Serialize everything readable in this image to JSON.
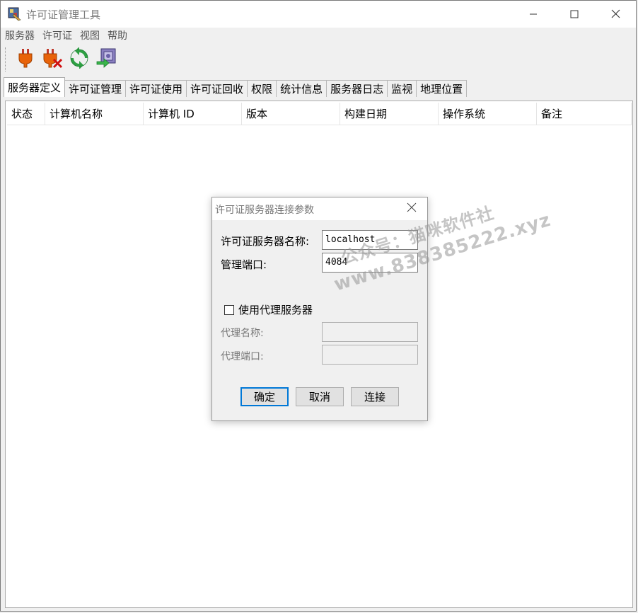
{
  "window": {
    "title": "许可证管理工具",
    "minimize": "—",
    "maximize": "☐",
    "close": "✕"
  },
  "menu": {
    "items": [
      "服务器",
      "许可证",
      "视图",
      "帮助"
    ]
  },
  "toolbar": {
    "buttons": [
      "connect-plug-icon",
      "disconnect-plug-icon",
      "refresh-icon",
      "export-icon"
    ]
  },
  "tabs": {
    "items": [
      "服务器定义",
      "许可证管理",
      "许可证使用",
      "许可证回收",
      "权限",
      "统计信息",
      "服务器日志",
      "监视",
      "地理位置"
    ],
    "active_index": 0
  },
  "table": {
    "columns": [
      "状态",
      "计算机名称",
      "计算机 ID",
      "版本",
      "构建日期",
      "操作系统",
      "备注"
    ],
    "rows": []
  },
  "dialog": {
    "title": "许可证服务器连接参数",
    "close": "✕",
    "server_name_label": "许可证服务器名称:",
    "server_name_value": "localhost",
    "port_label": "管理端口:",
    "port_value": "4084",
    "use_proxy_label": "使用代理服务器",
    "use_proxy_checked": false,
    "proxy_name_label": "代理名称:",
    "proxy_name_value": "",
    "proxy_port_label": "代理端口:",
    "proxy_port_value": "",
    "ok_label": "确定",
    "cancel_label": "取消",
    "connect_label": "连接"
  },
  "watermark": {
    "line1": "公众号：猫咪软件社",
    "line2": "www.838385222.xyz"
  },
  "colors": {
    "accent": "#0078d7",
    "window_bg": "#f0f0f0",
    "panel_bg": "#ffffff"
  }
}
